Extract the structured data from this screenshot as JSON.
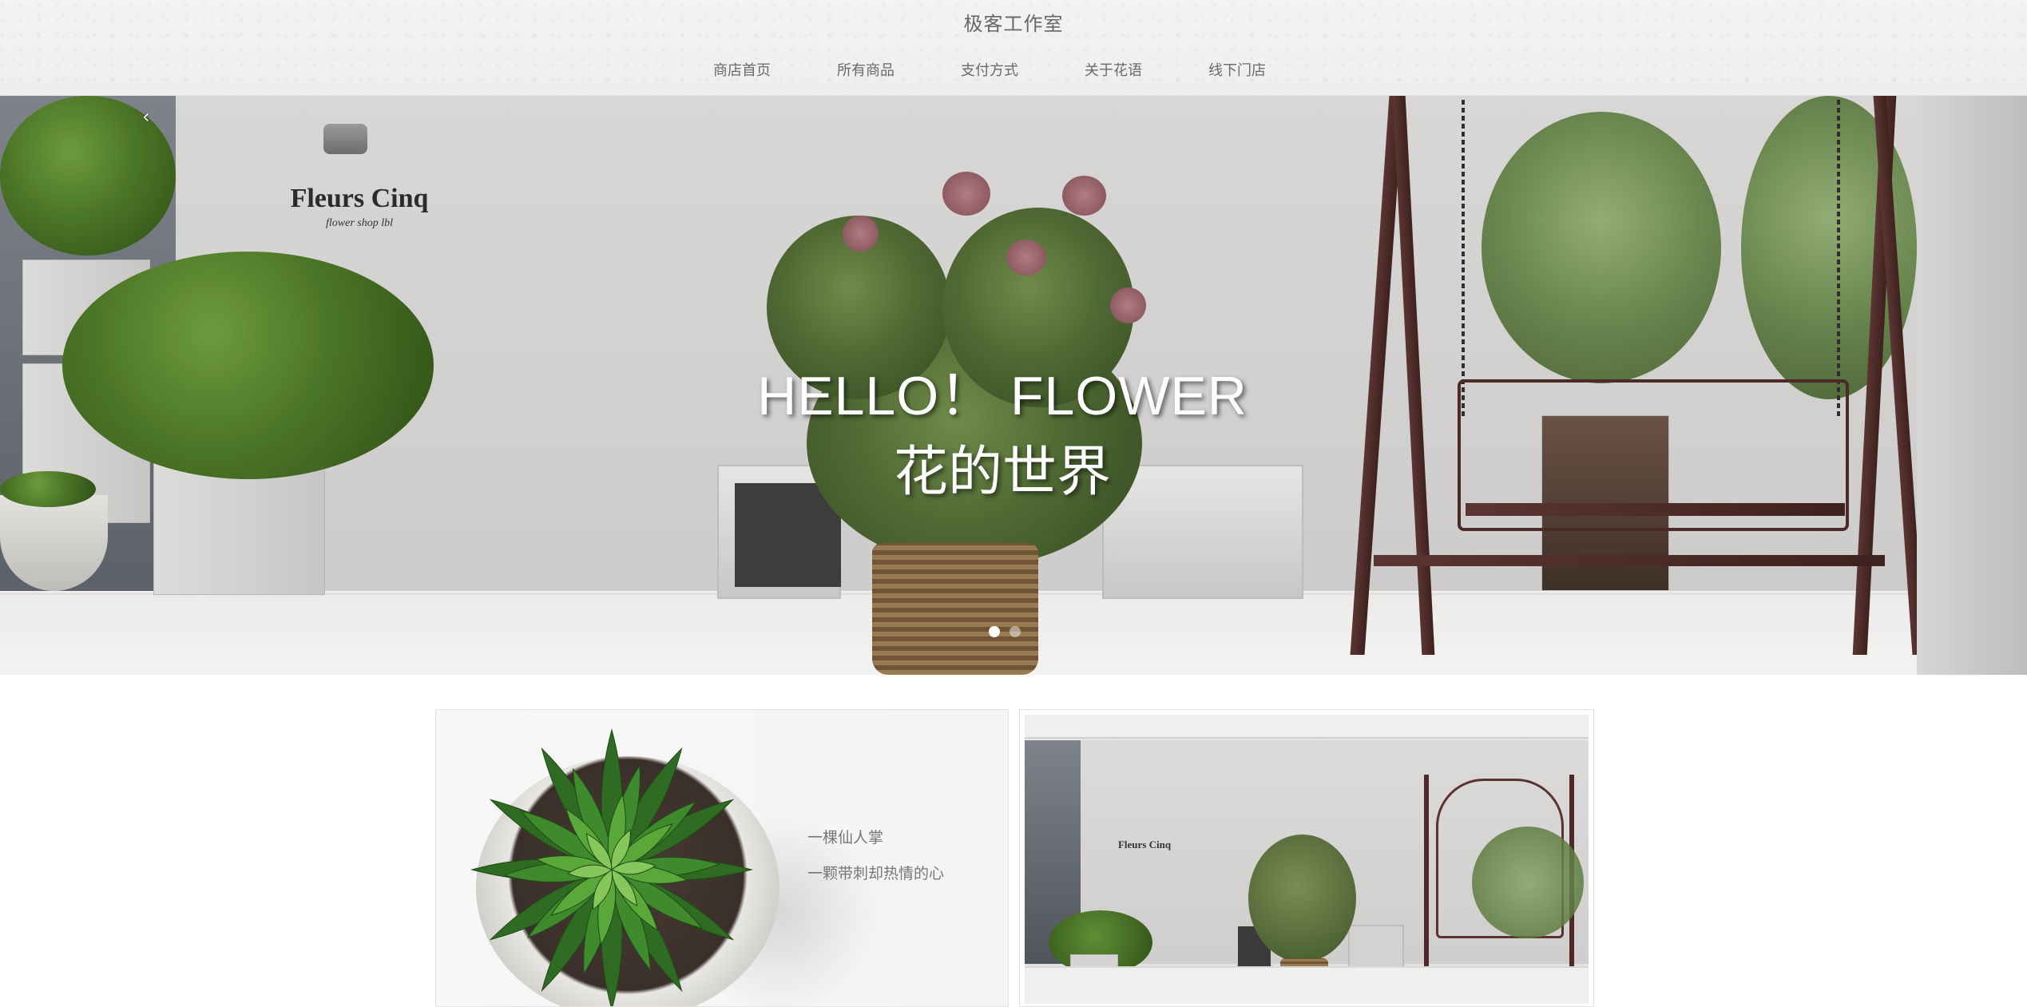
{
  "header": {
    "site_title": "极客工作室",
    "nav": [
      {
        "label": "商店首页"
      },
      {
        "label": "所有商品"
      },
      {
        "label": "支付方式"
      },
      {
        "label": "关于花语"
      },
      {
        "label": "线下门店"
      }
    ]
  },
  "banner": {
    "prev_arrow": "‹",
    "heading_line1": "HELLO！ FLOWER",
    "heading_line2": "花的世界",
    "brand_name": "Fleurs Cinq",
    "brand_sub": "flower shop lbl",
    "slides_count": 2,
    "active_slide": 1
  },
  "cards": {
    "left": {
      "caption_line1": "一棵仙人掌",
      "caption_line2": "一颗带刺却热情的心"
    },
    "right": {
      "brand_name": "Fleurs Cinq"
    }
  },
  "colors": {
    "nav_text": "#6a6a6a",
    "hero_text": "#ffffff",
    "caption_text": "#777777"
  }
}
